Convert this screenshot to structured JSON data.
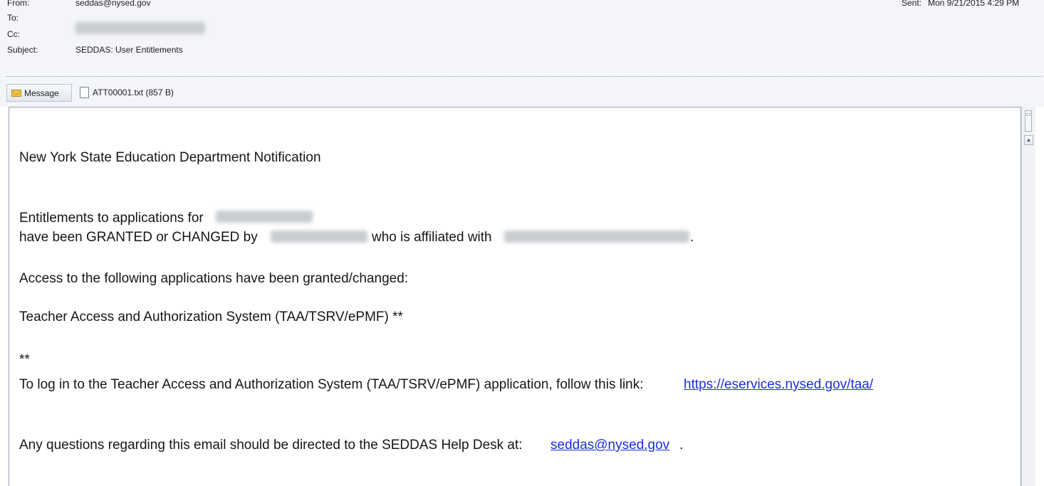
{
  "header": {
    "from_label": "From:",
    "from_value": "seddas@nysed.gov",
    "to_label": "To:",
    "cc_label": "Cc:",
    "subject_label": "Subject:",
    "subject_value": "SEDDAS: User Entitlements",
    "sent_label": "Sent:",
    "sent_value": "Mon 9/21/2015 4:29 PM"
  },
  "tabs": {
    "message_label": "Message",
    "attachment_label": "ATT00001.txt (857 B)"
  },
  "body": {
    "heading": "New York State Education Department Notification",
    "entitlements_line": "Entitlements to applications for",
    "granted_line_start": "have been GRANTED or CHANGED by",
    "affiliated_text": "who is affiliated with",
    "period": ".",
    "access_line": "Access to the following applications have been granted/changed:",
    "app_line": "Teacher Access and Authorization System (TAA/TSRV/ePMF) **",
    "stars": "**",
    "login_line": "To log in to the Teacher Access and Authorization System (TAA/TSRV/ePMF) application, follow this link:",
    "login_link": "https://eservices.nysed.gov/taa/",
    "questions_line": "Any questions regarding this email should be directed to the SEDDAS Help Desk at:",
    "help_email": "seddas@nysed.gov",
    "end_period": "."
  }
}
